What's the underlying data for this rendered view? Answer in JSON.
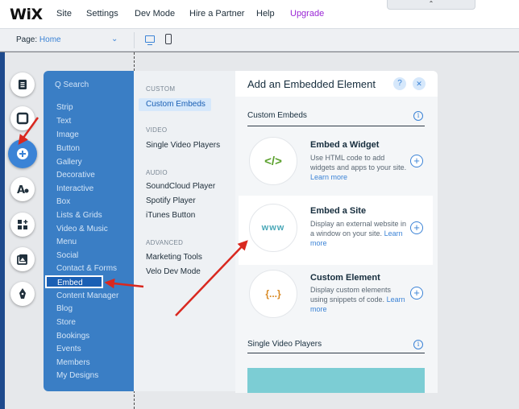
{
  "topbar": {
    "logo": "WiX",
    "menu": [
      "Site",
      "Settings",
      "Dev Mode",
      "Hire a Partner",
      "Help",
      "Upgrade"
    ],
    "collapse_glyph": "⌃"
  },
  "pagebar": {
    "page_prefix": "Page:",
    "page_name": "Home",
    "chevron": "⌄"
  },
  "rail": {
    "items": [
      "pages-icon",
      "background-icon",
      "add-icon",
      "design-icon",
      "app-market-icon",
      "media-icon",
      "blog-icon"
    ],
    "active": "add-icon",
    "accent": "#3b83d6"
  },
  "categories": {
    "search_placeholder": "Q Search",
    "items": [
      "Strip",
      "Text",
      "Image",
      "Button",
      "Gallery",
      "Decorative",
      "Interactive",
      "Box",
      "Lists & Grids",
      "Video & Music",
      "Menu",
      "Social",
      "Contact & Forms",
      "Embed",
      "Content Manager",
      "Blog",
      "Store",
      "Bookings",
      "Events",
      "Members",
      "My Designs"
    ],
    "selected": "Embed"
  },
  "subcategories": {
    "groups": [
      {
        "heading": "CUSTOM",
        "items": [
          "Custom Embeds"
        ]
      },
      {
        "heading": "VIDEO",
        "items": [
          "Single Video Players"
        ]
      },
      {
        "heading": "AUDIO",
        "items": [
          "SoundCloud Player",
          "Spotify Player",
          "iTunes Button"
        ]
      },
      {
        "heading": "ADVANCED",
        "items": [
          "Marketing Tools",
          "Velo Dev Mode"
        ]
      }
    ],
    "selected": "Custom Embeds"
  },
  "panel": {
    "title": "Add an Embedded Element",
    "help": "?",
    "close": "✕",
    "sections": [
      {
        "title": "Custom Embeds",
        "info": "i"
      },
      {
        "title": "Single Video Players",
        "info": "i"
      }
    ],
    "items": [
      {
        "badge": "</>",
        "badge_color": "#5aa02c",
        "title": "Embed a Widget",
        "desc": "Use HTML code to add widgets and apps to your site.",
        "more": "Learn more"
      },
      {
        "badge": "www",
        "badge_color": "#4aa8b8",
        "title": "Embed a Site",
        "desc": "Display an external website in a window on your site.",
        "more": "Learn more"
      },
      {
        "badge": "{...}",
        "badge_color": "#d98a24",
        "title": "Custom Element",
        "desc": "Display custom elements using snippets of code.",
        "more": "Learn more"
      }
    ],
    "add_glyph": "+"
  },
  "colors": {
    "annotation_arrow": "#d9281f",
    "panel_blue": "#3a7ec5"
  }
}
